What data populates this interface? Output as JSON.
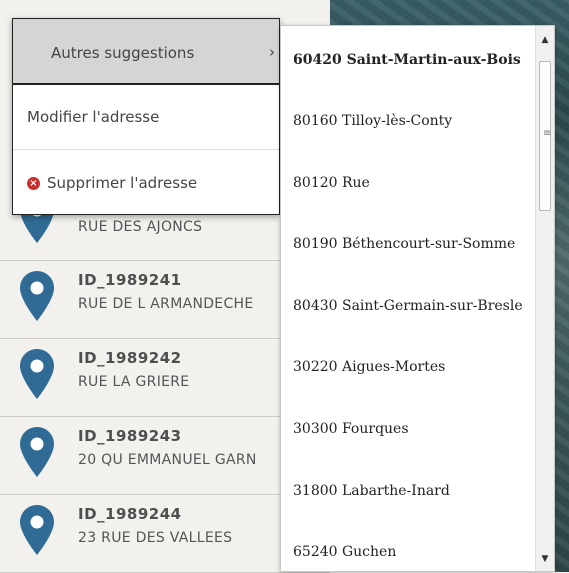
{
  "context_menu": {
    "other_suggestions": "Autres suggestions",
    "submenu_arrow": "›",
    "modify_address": "Modifier l'adresse",
    "delete_address": "Supprimer l'adresse"
  },
  "suggestions": [
    {
      "label": "60420 Saint-Martin-aux-Bois",
      "bold": true
    },
    {
      "label": "80160 Tilloy-lès-Conty"
    },
    {
      "label": "80120 Rue"
    },
    {
      "label": "80190 Béthencourt-sur-Somme"
    },
    {
      "label": "80430 Saint-Germain-sur-Bresle"
    },
    {
      "label": "30220 Aigues-Mortes"
    },
    {
      "label": "30300 Fourques"
    },
    {
      "label": "31800 Labarthe-Inard"
    },
    {
      "label": "65240 Guchen"
    }
  ],
  "address_list": [
    {
      "id": "",
      "address": "RUE DES AJONCS"
    },
    {
      "id": "ID_1989241",
      "address": "RUE DE L ARMANDECHE"
    },
    {
      "id": "ID_1989242",
      "address": "RUE LA GRIERE"
    },
    {
      "id": "ID_1989243",
      "address": "20 QU EMMANUEL GARN"
    },
    {
      "id": "ID_1989244",
      "address": "23 RUE DES VALLEES"
    }
  ],
  "colors": {
    "pin": "#2f6b94",
    "delete_icon": "#c9302c",
    "menu_highlight": "#d6d5d3"
  },
  "icons": {
    "pin": "map-pin-icon",
    "delete": "delete-circle-icon",
    "submenu": "chevron-right-icon"
  }
}
